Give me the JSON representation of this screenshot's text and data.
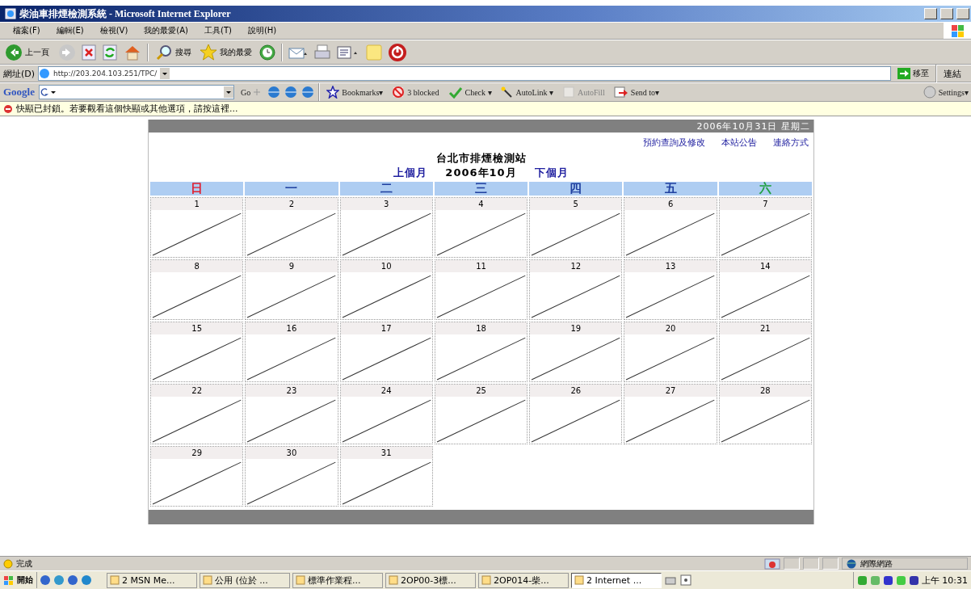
{
  "window": {
    "title": "柴油車排煙檢測系統 - Microsoft Internet Explorer"
  },
  "menu": [
    "檔案(F)",
    "編輯(E)",
    "檢視(V)",
    "我的最愛(A)",
    "工具(T)",
    "說明(H)"
  ],
  "toolbar": [
    {
      "kind": "back",
      "label": "上一頁"
    },
    {
      "kind": "forward"
    },
    {
      "kind": "stop"
    },
    {
      "kind": "refresh"
    },
    {
      "kind": "home"
    },
    {
      "kind": "search",
      "label": "搜尋"
    },
    {
      "kind": "favorites",
      "label": "我的最愛"
    },
    {
      "kind": "history"
    },
    {
      "kind": "mail"
    },
    {
      "kind": "print"
    },
    {
      "kind": "edit"
    },
    {
      "kind": "note"
    },
    {
      "kind": "power"
    }
  ],
  "address": {
    "label": "網址(D)",
    "value": "http://203.204.103.251/TPC/",
    "go": "移至",
    "links": "連結"
  },
  "google_bar": {
    "logo": "Google",
    "items": [
      {
        "kind": "go",
        "label": "Go",
        "disabled": false
      },
      {
        "kind": "bookmarks",
        "label": "Bookmarks▾",
        "disabled": false
      },
      {
        "kind": "blocked",
        "label": "3 blocked",
        "disabled": false
      },
      {
        "kind": "check",
        "label": "Check ▾",
        "disabled": false
      },
      {
        "kind": "autolink",
        "label": "AutoLink ▾",
        "disabled": false
      },
      {
        "kind": "autofill",
        "label": "AutoFill",
        "disabled": true
      },
      {
        "kind": "sendto",
        "label": "Send to▾",
        "disabled": false
      },
      {
        "kind": "settings",
        "label": "Settings▾",
        "disabled": false
      }
    ]
  },
  "info_bar": "快顯已封鎖。若要觀看這個快顯或其他選項，請按這裡...",
  "page": {
    "date": "2006年10月31日 星期二",
    "links": [
      "預約查詢及修改",
      "本站公告",
      "連絡方式"
    ],
    "station": "台北市排煙檢測站",
    "prev": "上個月",
    "month": "2006年10月",
    "next": "下個月",
    "weekdays": [
      {
        "label": "日",
        "color": "#e02030"
      },
      {
        "label": "一",
        "color": "#2040a0"
      },
      {
        "label": "二",
        "color": "#2040a0"
      },
      {
        "label": "三",
        "color": "#2040a0"
      },
      {
        "label": "四",
        "color": "#2040a0"
      },
      {
        "label": "五",
        "color": "#2040a0"
      },
      {
        "label": "六",
        "color": "#20a040"
      }
    ],
    "days": [
      {
        "day": "1",
        "crossed": true
      },
      {
        "day": "2",
        "crossed": true
      },
      {
        "day": "3",
        "crossed": true
      },
      {
        "day": "4",
        "crossed": true
      },
      {
        "day": "5",
        "crossed": true
      },
      {
        "day": "6",
        "crossed": true
      },
      {
        "day": "7",
        "crossed": true
      },
      {
        "day": "8",
        "crossed": true
      },
      {
        "day": "9",
        "crossed": true
      },
      {
        "day": "10",
        "crossed": true
      },
      {
        "day": "11",
        "crossed": true
      },
      {
        "day": "12",
        "crossed": true
      },
      {
        "day": "13",
        "crossed": true
      },
      {
        "day": "14",
        "crossed": true
      },
      {
        "day": "15",
        "crossed": true
      },
      {
        "day": "16",
        "crossed": true
      },
      {
        "day": "17",
        "crossed": true
      },
      {
        "day": "18",
        "crossed": true
      },
      {
        "day": "19",
        "crossed": true
      },
      {
        "day": "20",
        "crossed": true
      },
      {
        "day": "21",
        "crossed": true
      },
      {
        "day": "22",
        "crossed": true
      },
      {
        "day": "23",
        "crossed": true
      },
      {
        "day": "24",
        "crossed": true
      },
      {
        "day": "25",
        "crossed": true
      },
      {
        "day": "26",
        "crossed": true
      },
      {
        "day": "27",
        "crossed": true
      },
      {
        "day": "28",
        "crossed": true
      },
      {
        "day": "29",
        "crossed": true
      },
      {
        "day": "30",
        "crossed": true
      },
      {
        "day": "31",
        "crossed": true
      }
    ]
  },
  "status_bar": {
    "text": "完成",
    "zone": "網際網路"
  },
  "taskbar": {
    "start": "開始",
    "buttons": [
      {
        "label": "2 MSN Me...",
        "selected": false
      },
      {
        "label": "公用 (位於 ...",
        "selected": false
      },
      {
        "label": "標準作業程...",
        "selected": false
      },
      {
        "label": "2OP00-3標...",
        "selected": false
      },
      {
        "label": "2OP014-柴...",
        "selected": false
      },
      {
        "label": "2 Internet ...",
        "selected": true
      }
    ],
    "clock": "上午 10:31"
  }
}
